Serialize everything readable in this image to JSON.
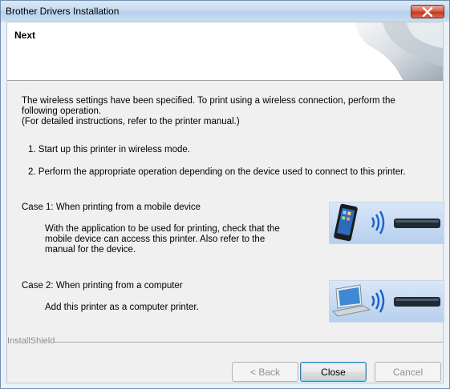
{
  "window": {
    "title": "Brother Drivers Installation"
  },
  "header": {
    "title": "Next"
  },
  "content": {
    "intro_line1": "The wireless settings have been specified. To print using a wireless connection, perform the",
    "intro_line2": "following operation.",
    "intro_line3": "(For detailed instructions, refer to the printer manual.)",
    "step1": "1. Start up this printer in wireless mode.",
    "step2": "2. Perform the appropriate operation depending on the device used to connect to this printer.",
    "case1_title": "Case 1: When printing from a mobile device",
    "case1_line1": "With the application to be used for printing, check that the",
    "case1_line2": "mobile device can access this printer. Also refer to the",
    "case1_line3": "manual for the device.",
    "case2_title": "Case 2: When printing from a computer",
    "case2_line1": "Add this printer as a computer printer."
  },
  "footer": {
    "brand": "InstallShield",
    "back_label": "< Back",
    "close_label": "Close",
    "cancel_label": "Cancel"
  },
  "icons": {
    "close": "close-icon",
    "mobile": "mobile-device-icon",
    "laptop": "laptop-icon",
    "wireless": "wireless-waves-icon",
    "printer": "printer-icon"
  },
  "colors": {
    "title_bar": "#c6dbf1",
    "close_button": "#c23a20",
    "illustration_bg": "#c8dbf3",
    "printer": "#1f2a36",
    "wireless": "#1c64c8"
  }
}
